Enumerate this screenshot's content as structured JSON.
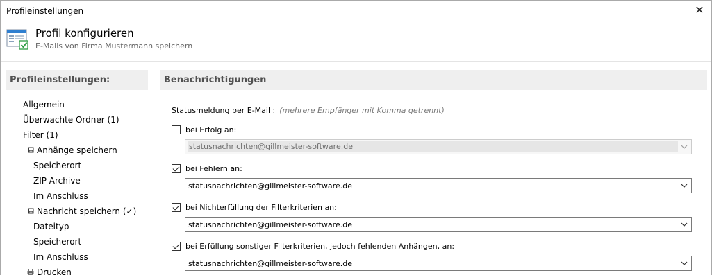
{
  "window": {
    "title": "Profileinstellungen",
    "close_glyph": "✕"
  },
  "header": {
    "title": "Profil konfigurieren",
    "subtitle": "E-Mails von Firma Mustermann speichern",
    "icon": "profile-settings-icon"
  },
  "left_panel": {
    "title": "Profileinstellungen:",
    "items": [
      {
        "label": "Allgemein",
        "level": 0,
        "icon": ""
      },
      {
        "label": "Überwachte Ordner (1)",
        "level": 0,
        "icon": ""
      },
      {
        "label": "Filter (1)",
        "level": 0,
        "icon": ""
      },
      {
        "label": "Anhänge speichern",
        "level": 0,
        "icon": "save-icon"
      },
      {
        "label": "Speicherort",
        "level": 1,
        "icon": ""
      },
      {
        "label": "ZIP-Archive",
        "level": 1,
        "icon": ""
      },
      {
        "label": "Im Anschluss",
        "level": 1,
        "icon": ""
      },
      {
        "label": "Nachricht speichern (✓)",
        "level": 0,
        "icon": "save-icon"
      },
      {
        "label": "Dateityp",
        "level": 1,
        "icon": ""
      },
      {
        "label": "Speicherort",
        "level": 1,
        "icon": ""
      },
      {
        "label": "Im Anschluss",
        "level": 1,
        "icon": ""
      },
      {
        "label": "Drucken",
        "level": 0,
        "icon": "printer-icon"
      }
    ]
  },
  "right_panel": {
    "title": "Benachrichtigungen",
    "status_label": "Statusmeldung per E-Mail :",
    "status_hint": "(mehrere Empfänger mit Komma getrennt)",
    "options": [
      {
        "label": "bei Erfolg an:",
        "checked": false,
        "value": "statusnachrichten@gillmeister-software.de",
        "enabled": false
      },
      {
        "label": "bei Fehlern an:",
        "checked": true,
        "value": "statusnachrichten@gillmeister-software.de",
        "enabled": true
      },
      {
        "label": "bei Nichterfüllung der Filterkriterien an:",
        "checked": true,
        "value": "statusnachrichten@gillmeister-software.de",
        "enabled": true
      },
      {
        "label": "bei Erfüllung sonstiger Filterkriterien, jedoch fehlenden Anhängen, an:",
        "checked": true,
        "value": "statusnachrichten@gillmeister-software.de",
        "enabled": true
      }
    ]
  },
  "colors": {
    "panel_header_bg": "#efefef",
    "panel_header_text": "#505050",
    "hint_text": "#777777",
    "icon_blue": "#2f7fd0",
    "icon_green": "#2e9e45"
  }
}
